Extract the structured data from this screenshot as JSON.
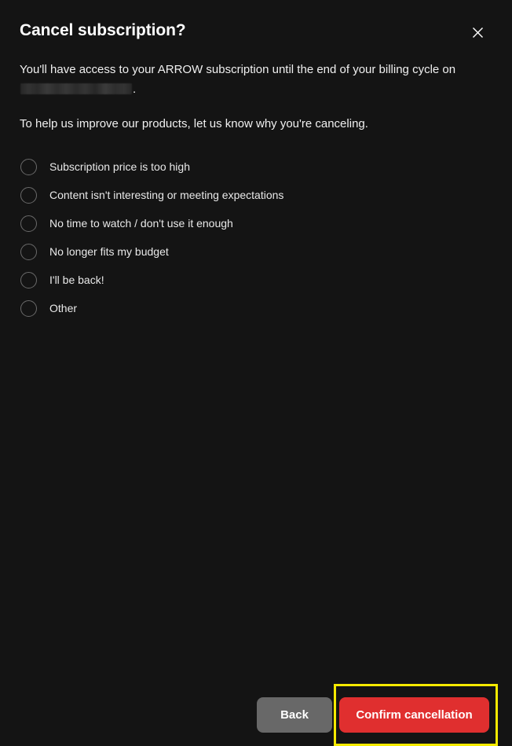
{
  "dialog": {
    "title": "Cancel subscription?",
    "close_icon": "close-icon",
    "body": {
      "line1_prefix": "You'll have access to your ARROW subscription until the end of your billing cycle on ",
      "redacted_value": "",
      "line1_suffix": "."
    },
    "prompt": "To help us improve our products, let us know why you're canceling.",
    "options": [
      {
        "label": "Subscription price is too high",
        "selected": false
      },
      {
        "label": "Content isn't interesting or meeting expectations",
        "selected": false
      },
      {
        "label": "No time to watch / don't use it enough",
        "selected": false
      },
      {
        "label": "No longer fits my budget",
        "selected": false
      },
      {
        "label": "I'll be back!",
        "selected": false
      },
      {
        "label": "Other",
        "selected": false
      }
    ],
    "footer": {
      "back_label": "Back",
      "confirm_label": "Confirm cancellation"
    }
  },
  "colors": {
    "background": "#141414",
    "confirm_red": "#e02f2f",
    "back_gray": "#686868",
    "focus_yellow": "#f5ea00",
    "radio_border": "#6a6a6a",
    "text_primary": "#ffffff",
    "text_secondary": "#e9e9e9",
    "redaction_bar": "#2e2e2e"
  }
}
